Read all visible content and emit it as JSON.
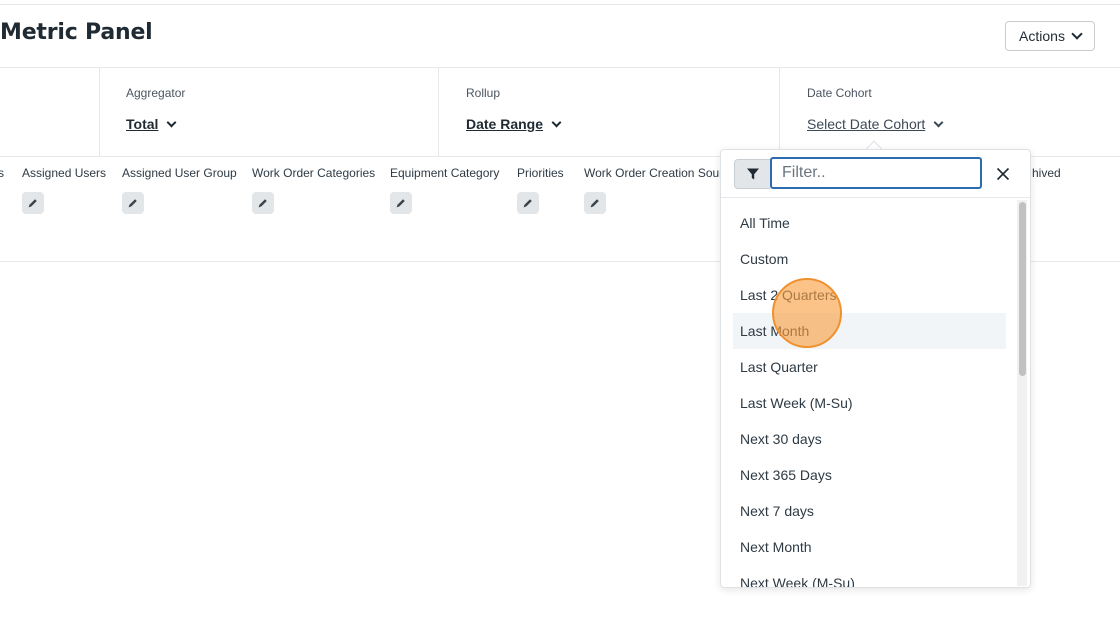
{
  "header": {
    "title": "Metric Panel",
    "actions_label": "Actions"
  },
  "config": {
    "aggregator": {
      "label": "Aggregator",
      "value": "Total"
    },
    "rollup": {
      "label": "Rollup",
      "value": "Date Range"
    },
    "date_cohort": {
      "label": "Date Cohort",
      "value": "Select Date Cohort"
    }
  },
  "filters": [
    {
      "label": "s"
    },
    {
      "label": "Assigned Users"
    },
    {
      "label": "Assigned User Group"
    },
    {
      "label": "Work Order Categories"
    },
    {
      "label": "Equipment Category"
    },
    {
      "label": "Priorities"
    },
    {
      "label": "Work Order Creation Source"
    },
    {
      "label": "hived"
    }
  ],
  "dropdown": {
    "filter_placeholder": "Filter..",
    "options": [
      "All Time",
      "Custom",
      "Last 2 Quarters",
      "Last Month",
      "Last Quarter",
      "Last Week (M-Su)",
      "Next 30 days",
      "Next 365 Days",
      "Next 7 days",
      "Next Month",
      "Next Week (M-Su)"
    ],
    "hovered_option": "Last Month"
  },
  "colors": {
    "accent": "#2b6cb0",
    "click_marker": "#f99e3f",
    "text": "#1f2a33"
  }
}
